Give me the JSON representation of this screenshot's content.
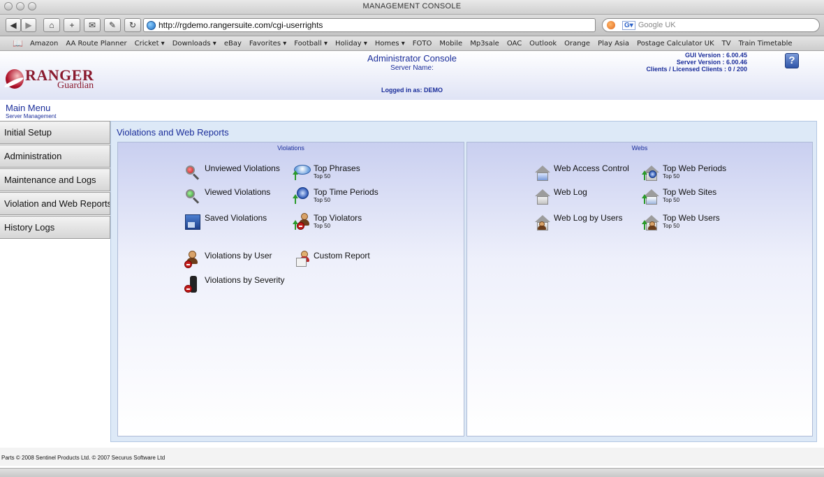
{
  "browser": {
    "window_title": "MANAGEMENT CONSOLE",
    "url": "http://rgdemo.rangersuite.com/cgi-userrights",
    "search_placeholder": "Google UK",
    "bookmarks": [
      "Amazon",
      "AA Route Planner",
      "Cricket ▾",
      "Downloads ▾",
      "eBay",
      "Favorites ▾",
      "Football ▾",
      "Holiday ▾",
      "Homes ▾",
      "FOTO",
      "Mobile",
      "Mp3sale",
      "OAC",
      "Outlook",
      "Orange",
      "Play Asia",
      "Postage Calculator UK",
      "TV",
      "Train Timetable"
    ]
  },
  "header": {
    "logo_ranger": "RANGER",
    "logo_guardian": "Guardian",
    "console_title": "Administrator Console",
    "server_name": "Server Name:",
    "logged_in": "Logged in as: DEMO",
    "gui_version": "GUI Version : 6.00.45",
    "server_version": "Server Version : 6.00.46",
    "clients": "Clients / Licensed Clients : 0 / 200",
    "help_label": "?"
  },
  "menu": {
    "title": "Main Menu",
    "subtitle": "Server Management",
    "items": [
      {
        "label": "Initial Setup"
      },
      {
        "label": "Administration"
      },
      {
        "label": "Maintenance and Logs"
      },
      {
        "label": "Violation and Web Reports"
      },
      {
        "label": "History Logs"
      }
    ]
  },
  "content": {
    "title": "Violations and Web Reports",
    "violations": {
      "heading": "Violations",
      "unviewed": "Unviewed Violations",
      "viewed": "Viewed Violations",
      "saved": "Saved Violations",
      "by_user": "Violations by User",
      "by_severity": "Violations by Severity",
      "top_phrases": "Top Phrases",
      "top_time_periods": "Top Time Periods",
      "top_violators": "Top Violators",
      "custom_report": "Custom Report",
      "top50": "Top 50"
    },
    "webs": {
      "heading": "Webs",
      "access_control": "Web Access Control",
      "web_log": "Web Log",
      "web_log_users": "Web Log by Users",
      "top_periods": "Top Web Periods",
      "top_sites": "Top Web Sites",
      "top_users": "Top Web Users",
      "top50": "Top 50"
    }
  },
  "footer": {
    "copyright": "Parts © 2008 Sentinel Products Ltd. © 2007 Securus Software Ltd"
  },
  "colors": {
    "accent": "#1a2d9a",
    "brand": "#8a1a2e",
    "content_bg": "#dde9f7"
  }
}
